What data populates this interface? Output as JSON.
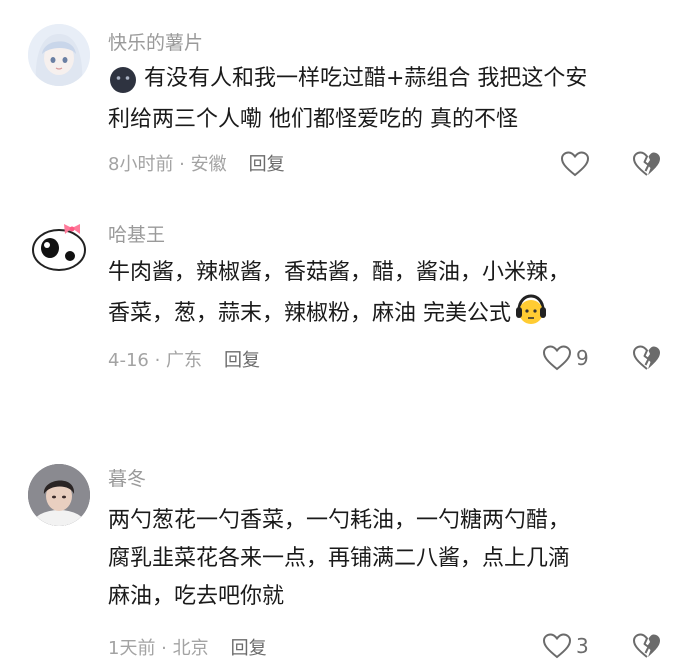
{
  "comments": [
    {
      "username": "快乐的薯片",
      "line1": "有没有人和我一样吃过醋+蒜组合 我把这个安",
      "line2": "利给两三个人嘞 他们都怪爱吃的 真的不怪",
      "meta": "8小时前 · 安徽",
      "reply_label": "回复",
      "like_count": ""
    },
    {
      "username": "哈基王",
      "line1": "牛肉酱，辣椒酱，香菇酱，醋，酱油，小米辣，",
      "line2": "香菜，葱，蒜末，辣椒粉，麻油 完美公式",
      "meta": "4-16 · 广东",
      "reply_label": "回复",
      "like_count": "9"
    },
    {
      "username": "暮冬",
      "line1": "两勺葱花一勺香菜，一勺耗油，一勺糖两勺醋，",
      "line2": "腐乳韭菜花各来一点，再铺满二八酱，点上几滴",
      "line3": "麻油，吃去吧你就",
      "meta": "1天前 · 北京",
      "reply_label": "回复",
      "like_count": "3"
    }
  ],
  "colors": {
    "username": "#9a9a9a",
    "meta": "#a3a3a3",
    "text": "#1a1a1a",
    "icon": "#6b6b6b"
  }
}
